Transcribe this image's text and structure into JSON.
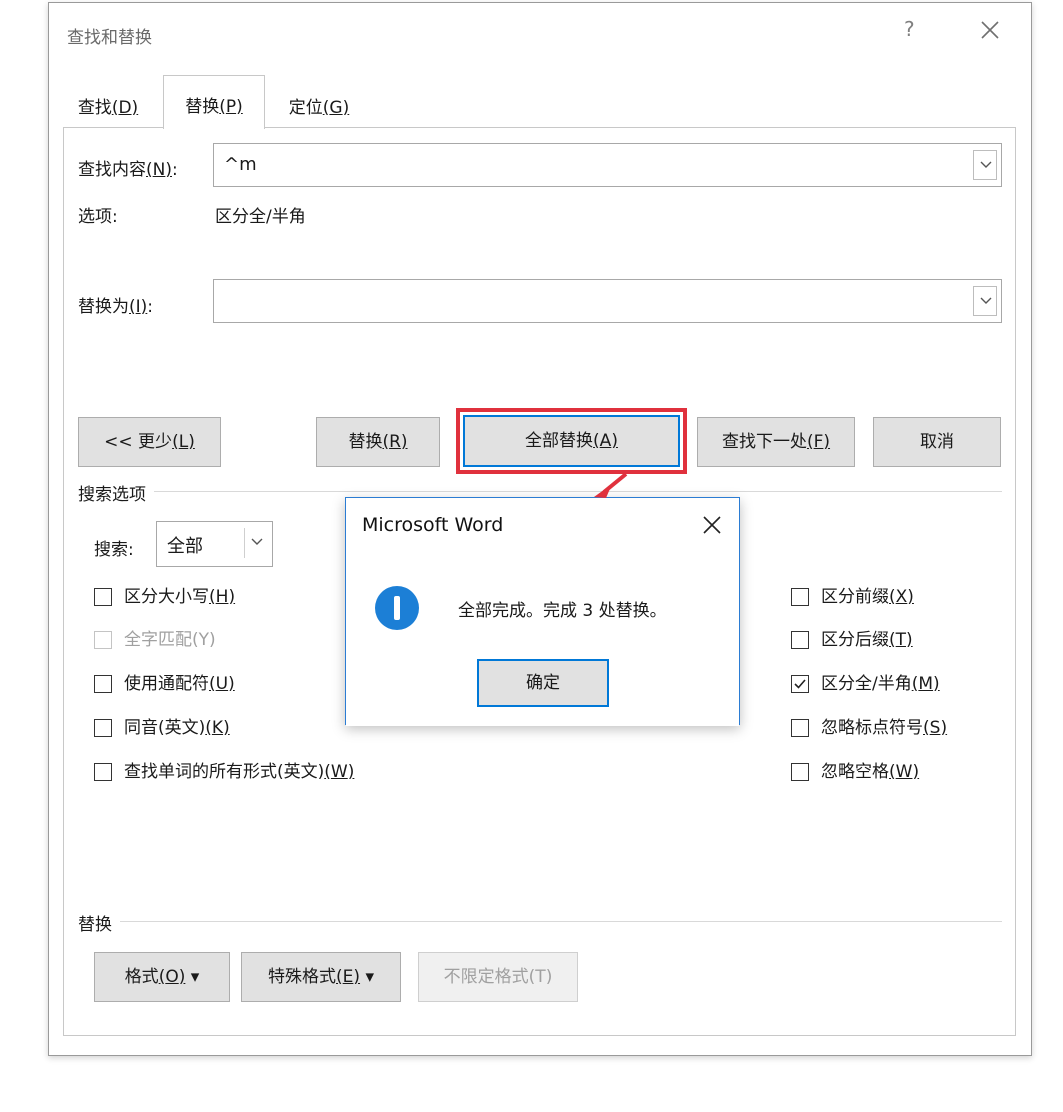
{
  "window": {
    "title": "查找和替换",
    "help_label": "?"
  },
  "tabs": [
    {
      "label": "查找",
      "key": "D"
    },
    {
      "label": "替换",
      "key": "P"
    },
    {
      "label": "定位",
      "key": "G"
    }
  ],
  "find": {
    "label": "查找内容",
    "key": "N",
    "value": "^m",
    "options_label": "选项:",
    "options_value": "区分全/半角"
  },
  "replace": {
    "label": "替换为",
    "key": "I",
    "value": ""
  },
  "buttons": {
    "less": {
      "prefix": "<< 更少",
      "key": "L"
    },
    "replace": {
      "label": "替换",
      "key": "R"
    },
    "replace_all": {
      "label": "全部替换",
      "key": "A"
    },
    "find_next": {
      "label": "查找下一处",
      "key": "F"
    },
    "cancel": {
      "label": "取消"
    }
  },
  "search_options": {
    "title": "搜索选项",
    "search_label": "搜索",
    "search_value": "全部",
    "left_checks": [
      {
        "label": "区分大小写",
        "key": "H",
        "checked": false,
        "disabled": false
      },
      {
        "label": "全字匹配",
        "key": "Y",
        "checked": false,
        "disabled": true
      },
      {
        "label": "使用通配符",
        "key": "U",
        "checked": false,
        "disabled": false
      },
      {
        "label": "同音(英文)",
        "key": "K",
        "checked": false,
        "disabled": false
      },
      {
        "label": "查找单词的所有形式(英文)",
        "key": "W",
        "checked": false,
        "disabled": false
      }
    ],
    "right_checks": [
      {
        "label": "区分前缀",
        "key": "X",
        "checked": false
      },
      {
        "label": "区分后缀",
        "key": "T",
        "checked": false
      },
      {
        "label": "区分全/半角",
        "key": "M",
        "checked": true
      },
      {
        "label": "忽略标点符号",
        "key": "S",
        "checked": false
      },
      {
        "label": "忽略空格",
        "key": "W",
        "checked": false
      }
    ]
  },
  "replace_section": {
    "title": "替换",
    "format": {
      "label": "格式",
      "key": "O"
    },
    "special": {
      "label": "特殊格式",
      "key": "E"
    },
    "no_format": {
      "label": "不限定格式(T)"
    }
  },
  "dialog": {
    "title": "Microsoft Word",
    "message": "全部完成。完成 3 处替换。",
    "ok_label": "确定"
  },
  "colors": {
    "accent_blue": "#0078d7",
    "highlight_red": "#e0313d",
    "info_blue": "#1c7fd6"
  }
}
